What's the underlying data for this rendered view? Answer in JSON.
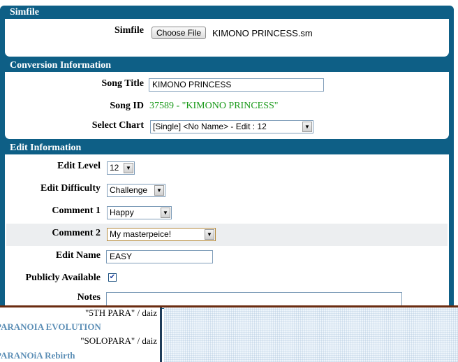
{
  "simfile": {
    "header": "Simfile",
    "label": "Simfile",
    "choose_button": "Choose File",
    "file_name": "KIMONO PRINCESS.sm"
  },
  "conversion": {
    "header": "Conversion Information",
    "song_title_label": "Song Title",
    "song_title_value": "KIMONO PRINCESS",
    "song_id_label": "Song ID",
    "song_id_value": "37589 - \"KIMONO PRINCESS\"",
    "select_chart_label": "Select Chart",
    "select_chart_value": "[Single] <No Name> - Edit : 12"
  },
  "edit": {
    "header": "Edit Information",
    "edit_level_label": "Edit Level",
    "edit_level_value": "12",
    "edit_difficulty_label": "Edit Difficulty",
    "edit_difficulty_value": "Challenge",
    "comment1_label": "Comment 1",
    "comment1_value": "Happy",
    "comment2_label": "Comment 2",
    "comment2_value": "My masterpeice!",
    "edit_name_label": "Edit Name",
    "edit_name_value": "EASY",
    "publicly_available_label": "Publicly Available",
    "publicly_available_checked": true,
    "notes_label": "Notes",
    "notes_value": ""
  },
  "bottom_list": [
    {
      "text": "\"5TH PARA\" / daiz",
      "style": "plain"
    },
    {
      "text": "PARANOIA EVOLUTION",
      "style": "blue"
    },
    {
      "text": "\"SOLOPARA\" / daiz",
      "style": "plain"
    },
    {
      "text": "PARANOiA Rebirth",
      "style": "blue"
    }
  ],
  "colors": {
    "header_bg": "#0e5f86",
    "song_id_color": "#1a9a1a",
    "list_title_color": "#5d8fb6"
  },
  "icons": {
    "dropdown": "chevron-down-icon",
    "checkbox": "check-icon"
  }
}
